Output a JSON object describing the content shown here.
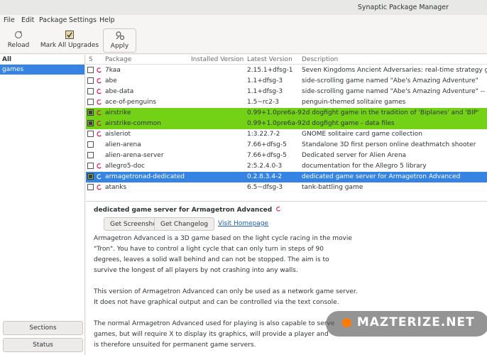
{
  "window": {
    "title": "Synaptic Package Manager"
  },
  "menu": [
    "File",
    "Edit",
    "Package",
    "Settings",
    "Help"
  ],
  "toolbar": {
    "reload": "Reload",
    "mark_all": "Mark All Upgrades",
    "apply": "Apply"
  },
  "sidebar": {
    "header": "All",
    "items": [
      "games"
    ],
    "sections_button": "Sections",
    "status_button": "Status"
  },
  "table": {
    "columns": [
      "S",
      "Package",
      "Installed Version",
      "Latest Version",
      "Description"
    ],
    "rows": [
      {
        "pkg": "7kaa",
        "installed": "",
        "latest": "2.15.1+dfsg-1",
        "desc": "Seven Kingdoms Ancient Adversaries: real-time strategy game",
        "state": ""
      },
      {
        "pkg": "abe",
        "installed": "",
        "latest": "1.1+dfsg-3",
        "desc": "side-scrolling game named \"Abe's Amazing Adventure\"",
        "state": ""
      },
      {
        "pkg": "abe-data",
        "installed": "",
        "latest": "1.1+dfsg-3",
        "desc": "side-scrolling game named \"Abe's Amazing Adventure\" -- data",
        "state": ""
      },
      {
        "pkg": "ace-of-penguins",
        "installed": "",
        "latest": "1.5~rc2-3",
        "desc": "penguin-themed solitaire games",
        "state": ""
      },
      {
        "pkg": "airstrike",
        "installed": "",
        "latest": "0.99+1.0pre6a-9",
        "desc": "2d dogfight game in the tradition of 'Biplanes' and 'BIP'",
        "state": "green"
      },
      {
        "pkg": "airstrike-common",
        "installed": "",
        "latest": "0.99+1.0pre6a-9",
        "desc": "2d dogfight game - data files",
        "state": "green"
      },
      {
        "pkg": "aisleriot",
        "installed": "",
        "latest": "1:3.22.7-2",
        "desc": "GNOME solitaire card game collection",
        "state": ""
      },
      {
        "pkg": "alien-arena",
        "installed": "",
        "latest": "7.66+dfsg-5",
        "desc": "Standalone 3D first person online deathmatch shooter",
        "state": ""
      },
      {
        "pkg": "alien-arena-server",
        "installed": "",
        "latest": "7.66+dfsg-5",
        "desc": "Dedicated server for Alien Arena",
        "state": ""
      },
      {
        "pkg": "allegro5-doc",
        "installed": "",
        "latest": "2:5.2.4.0-3",
        "desc": "documentation for the Allegro 5 library",
        "state": ""
      },
      {
        "pkg": "armagetronad-dedicated",
        "installed": "",
        "latest": "0.2.8.3.4-2",
        "desc": "dedicated game server for Armagetron Advanced",
        "state": "selected"
      },
      {
        "pkg": "atanks",
        "installed": "",
        "latest": "6.5~dfsg-3",
        "desc": "tank-battling game",
        "state": ""
      }
    ]
  },
  "details": {
    "title": "dedicated game server for Armagetron Advanced",
    "btn_screenshot": "Get Screenshot",
    "btn_changelog": "Get Changelog",
    "link_homepage": "Visit Homepage",
    "para1": [
      "Armagetron Advanced is a 3D game based on the light cycle racing in the movie",
      "\"Tron\". You have to control a light cycle that can only turn in steps of 90",
      "degrees, leaves a solid wall behind and can not be stopped.  The aim is to",
      "survive the longest of all players by not crashing into any walls."
    ],
    "para2": [
      "This version of Armagetron Advanced can only be used as a network game server.",
      "It does not have graphical output and can be controlled via the text console."
    ],
    "para3": [
      "The normal Armagetron Advanced used for playing is also capable to serve",
      "games, but will require X to display its graphics, will provide a player and",
      "is therefore unsuited for permanent game servers."
    ]
  },
  "watermark": "MAZTERIZE.NET",
  "colors": {
    "selection": "#3584e4",
    "marked": "#73d216",
    "link": "#1a5fb4"
  }
}
